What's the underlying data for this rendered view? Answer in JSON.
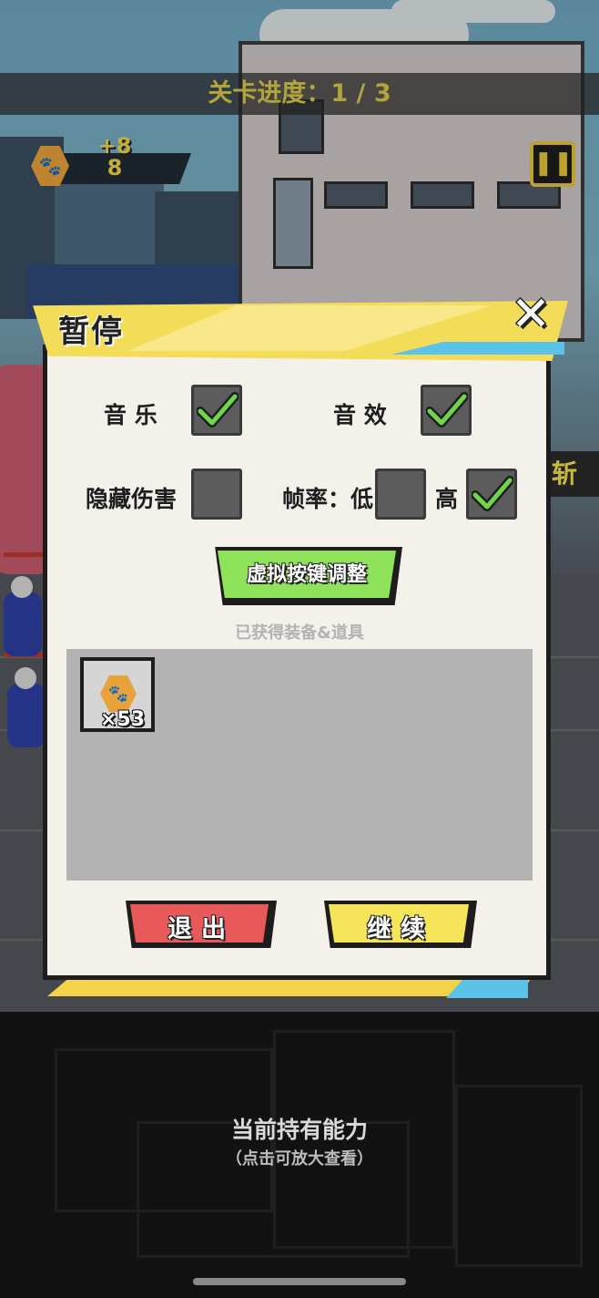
{
  "hud": {
    "stage_progress": "关卡进度：1 / 3",
    "coin_gain": "+8",
    "coin_count": "8",
    "coin_icon": "paw-coin-icon",
    "pause_icon": "pause-icon",
    "side_banner_text": "斩"
  },
  "dialog": {
    "title": "暂停",
    "close_icon": "close-x-icon",
    "options": {
      "music_label": "音 乐",
      "music_checked": true,
      "sfx_label": "音 效",
      "sfx_checked": true,
      "hide_damage_label": "隐藏伤害",
      "hide_damage_checked": false,
      "framerate_label": "帧率：低",
      "framerate_low_checked": false,
      "framerate_high_label": "高",
      "framerate_high_checked": true
    },
    "virtual_keys_button": "虚拟按键调整",
    "items_caption": "已获得装备&道具",
    "items": [
      {
        "icon": "paw-coin-icon",
        "count": "×53"
      }
    ],
    "exit_button": "退出",
    "continue_button": "继续"
  },
  "footer": {
    "abilities_title": "当前持有能力",
    "abilities_hint": "（点击可放大查看）"
  },
  "colors": {
    "header_yellow": "#f3dc58",
    "accent_blue": "#5bc3e8",
    "check_green": "#6fd64a",
    "exit_red": "#e85a5a",
    "continue_yellow": "#f6e45a",
    "vk_green": "#8fe35a"
  }
}
